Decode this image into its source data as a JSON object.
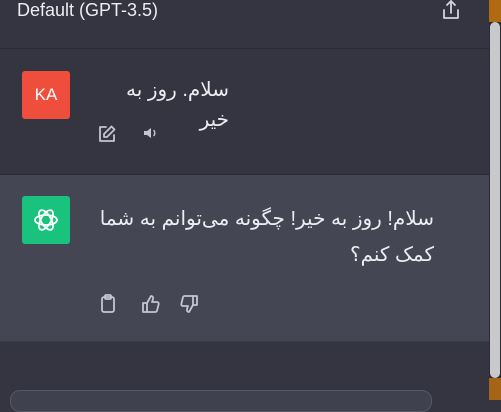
{
  "header": {
    "model_label": "Default (GPT-3.5)",
    "share_icon": "share-icon"
  },
  "conversation": {
    "user_message": {
      "avatar_initials": "KA",
      "avatar_color": "#f04e3c",
      "text": "سلام. روز به خیر",
      "actions": [
        "edit-icon",
        "speaker-icon"
      ]
    },
    "assistant_message": {
      "avatar_icon": "openai-logo-icon",
      "avatar_color": "#19c37d",
      "text": "سلام! روز به خیر! چگونه می‌توانم به شما کمک کنم؟",
      "actions": [
        "copy-icon",
        "thumbs-up-icon",
        "thumbs-down-icon"
      ]
    }
  },
  "colors": {
    "background": "#343541",
    "assistant_background": "#444654"
  }
}
